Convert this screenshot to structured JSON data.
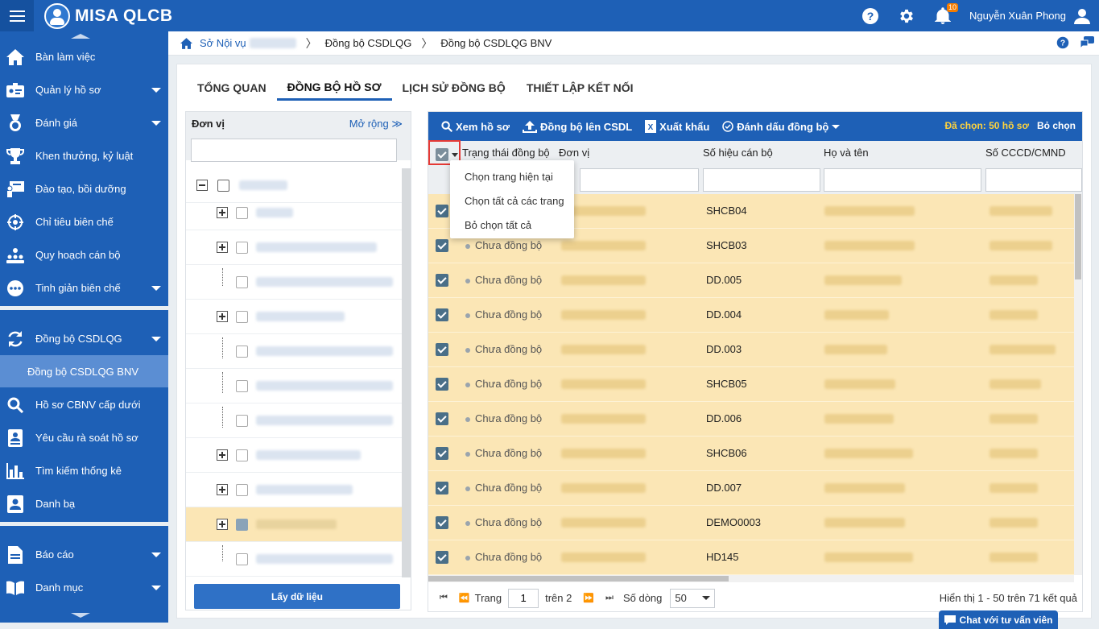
{
  "app": {
    "logo": "MISA QLCB"
  },
  "topbar": {
    "username": "Nguyễn Xuân Phong",
    "notification_count": "10"
  },
  "sidebar": {
    "items": [
      {
        "label": "Bàn làm việc"
      },
      {
        "label": "Quản lý hồ sơ"
      },
      {
        "label": "Đánh giá"
      },
      {
        "label": "Khen thưởng, kỷ luật"
      },
      {
        "label": "Đào tạo, bồi dưỡng"
      },
      {
        "label": "Chỉ tiêu biên chế"
      },
      {
        "label": "Quy hoạch cán bộ"
      },
      {
        "label": "Tinh giản biên chế"
      },
      {
        "label": "Đồng bộ CSDLQG"
      },
      {
        "label": "Đồng bộ CSDLQG BNV"
      },
      {
        "label": "Hồ sơ CBNV cấp dưới"
      },
      {
        "label": "Yêu cầu rà soát hồ sơ"
      },
      {
        "label": "Tìm kiếm thống kê"
      },
      {
        "label": "Danh bạ"
      },
      {
        "label": "Báo cáo"
      },
      {
        "label": "Danh mục"
      }
    ]
  },
  "breadcrumb": {
    "root": "Sở Nội vụ",
    "level1": "Đồng bộ CSDLQG",
    "level2": "Đồng bộ CSDLQG BNV"
  },
  "tabs": [
    "TỔNG QUAN",
    "ĐỒNG BỘ HỒ SƠ",
    "LỊCH SỬ ĐỒNG BỘ",
    "THIẾT LẬP KẾT NỐI"
  ],
  "tree": {
    "header": "Đơn vị",
    "expand": "Mở rộng",
    "load_button": "Lấy dữ liệu"
  },
  "toolbar": {
    "view": "Xem hồ sơ",
    "sync": "Đồng bộ lên CSDL",
    "export": "Xuất khẩu",
    "mark": "Đánh dấu đồng bộ",
    "selected": "Đã chọn: 50 hồ sơ",
    "deselect": "Bỏ chọn"
  },
  "columns": {
    "status": "Trạng thái đồng bộ",
    "unit": "Đơn vị",
    "code": "Số hiệu cán bộ",
    "name": "Họ và tên",
    "id": "Số CCCD/CMND"
  },
  "select_menu": [
    "Chọn trang hiện tại",
    "Chọn tất cả các trang",
    "Bỏ chọn tất cả"
  ],
  "rows": [
    {
      "status": "",
      "code": "SHCB04"
    },
    {
      "status": "Chưa đồng bộ",
      "code": "SHCB03"
    },
    {
      "status": "Chưa đồng bộ",
      "code": "DD.005"
    },
    {
      "status": "Chưa đồng bộ",
      "code": "DD.004"
    },
    {
      "status": "Chưa đồng bộ",
      "code": "DD.003"
    },
    {
      "status": "Chưa đồng bộ",
      "code": "SHCB05"
    },
    {
      "status": "Chưa đồng bộ",
      "code": "DD.006"
    },
    {
      "status": "Chưa đồng bộ",
      "code": "SHCB06"
    },
    {
      "status": "Chưa đồng bộ",
      "code": "DD.007"
    },
    {
      "status": "Chưa đồng bộ",
      "code": "DEMO0003"
    },
    {
      "status": "Chưa đồng bộ",
      "code": "HD145"
    }
  ],
  "pager": {
    "page_label": "Trang",
    "page": "1",
    "of_label": "trên 2",
    "rows_label": "Số dòng",
    "page_size": "50",
    "info": "Hiển thị 1 - 50 trên 71 kết quả"
  },
  "chat": {
    "label": "Chat với tư vấn viên"
  }
}
